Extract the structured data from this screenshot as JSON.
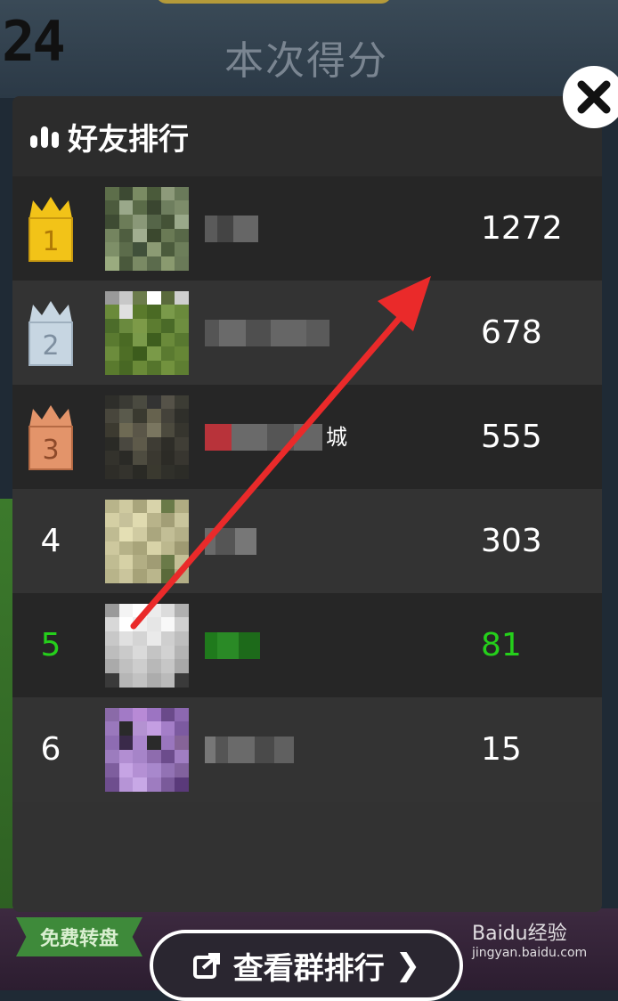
{
  "background": {
    "score_digits": "24",
    "score_title": "本次得分",
    "free_spin_label": "免费转盘",
    "group_rank_label": "查看群排行",
    "group_rank_chevron": "❯",
    "watermark_main": "Baidu经验",
    "watermark_sub": "jingyan.baidu.com"
  },
  "modal": {
    "title": "好友排行",
    "title_icon": "bar-chart-icon",
    "close_icon": "close-icon",
    "rows": [
      {
        "rank": "1",
        "badge": "gold-crown-badge",
        "score": "1272",
        "is_me": false,
        "name_blurred": true
      },
      {
        "rank": "2",
        "badge": "silver-crown-badge",
        "score": "678",
        "is_me": false,
        "name_blurred": true
      },
      {
        "rank": "3",
        "badge": "bronze-crown-badge",
        "score": "555",
        "is_me": false,
        "name_blurred": true
      },
      {
        "rank": "4",
        "badge": null,
        "score": "303",
        "is_me": false,
        "name_blurred": true
      },
      {
        "rank": "5",
        "badge": null,
        "score": "81",
        "is_me": true,
        "name_blurred": true
      },
      {
        "rank": "6",
        "badge": null,
        "score": "15",
        "is_me": false,
        "name_blurred": true
      }
    ],
    "row_name_suffix_3": "城"
  },
  "colors": {
    "highlight": "#25cf1b",
    "gold": "#f2c318",
    "silver": "#c7d6e2",
    "bronze": "#e3946a",
    "arrow": "#ea2a2a"
  }
}
